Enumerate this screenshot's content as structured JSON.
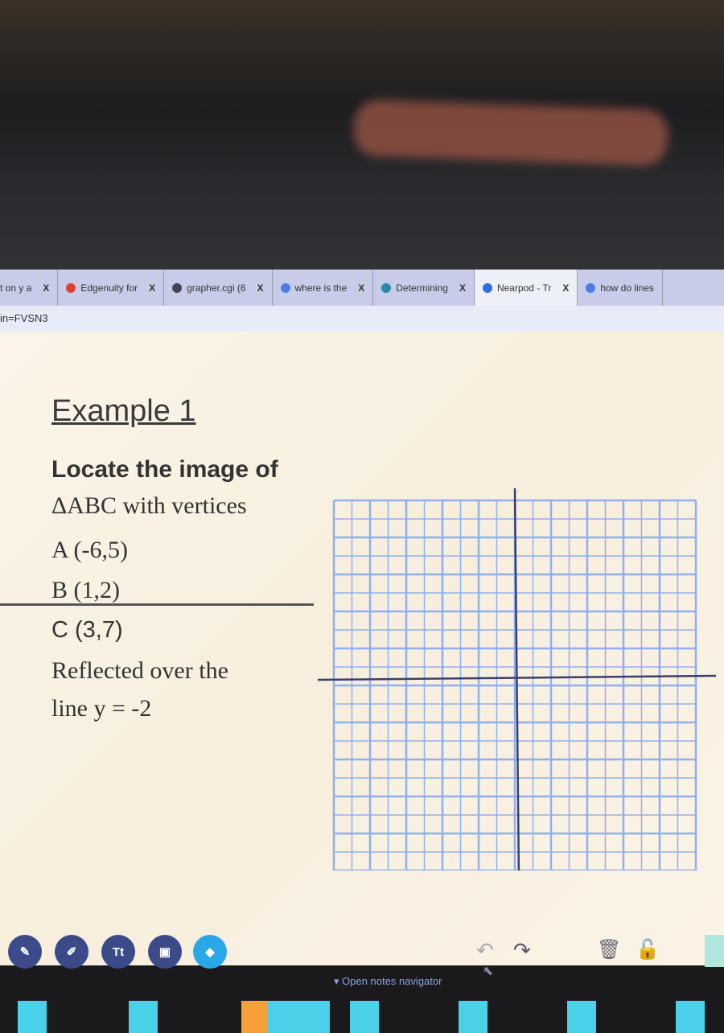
{
  "browser": {
    "tabs": [
      {
        "label": "t on y a",
        "icon": "page-icon",
        "active": false
      },
      {
        "label": "Edgenuity for",
        "icon": "edgenuity-icon",
        "active": false
      },
      {
        "label": "grapher.cgi (6",
        "icon": "globe-icon",
        "active": false
      },
      {
        "label": "where is the",
        "icon": "google-icon",
        "active": false
      },
      {
        "label": "Determining",
        "icon": "check-circle-icon",
        "active": false
      },
      {
        "label": "Nearpod - Tr",
        "icon": "nearpod-icon",
        "active": true
      },
      {
        "label": "how do lines",
        "icon": "google-icon",
        "active": false
      }
    ],
    "close_label": "X",
    "url_fragment": "in=FVSN3"
  },
  "slide": {
    "title": "Example 1",
    "line1": "Locate the image of",
    "line2": "ΔABC with vertices",
    "vertex_a": "A (-6,5)",
    "vertex_b": "B (1,2)",
    "vertex_c": "C (3,7)",
    "line3": "Reflected over  the",
    "line4": "line  y = -2"
  },
  "toolbar": {
    "text_tool_label": "Tt",
    "notes_navigator": "Open notes navigator"
  },
  "colors": {
    "grid": "#8fb0f0",
    "axis": "#3a3f6a",
    "tool": "#3d4a8a",
    "eraser": "#29a8e8"
  }
}
